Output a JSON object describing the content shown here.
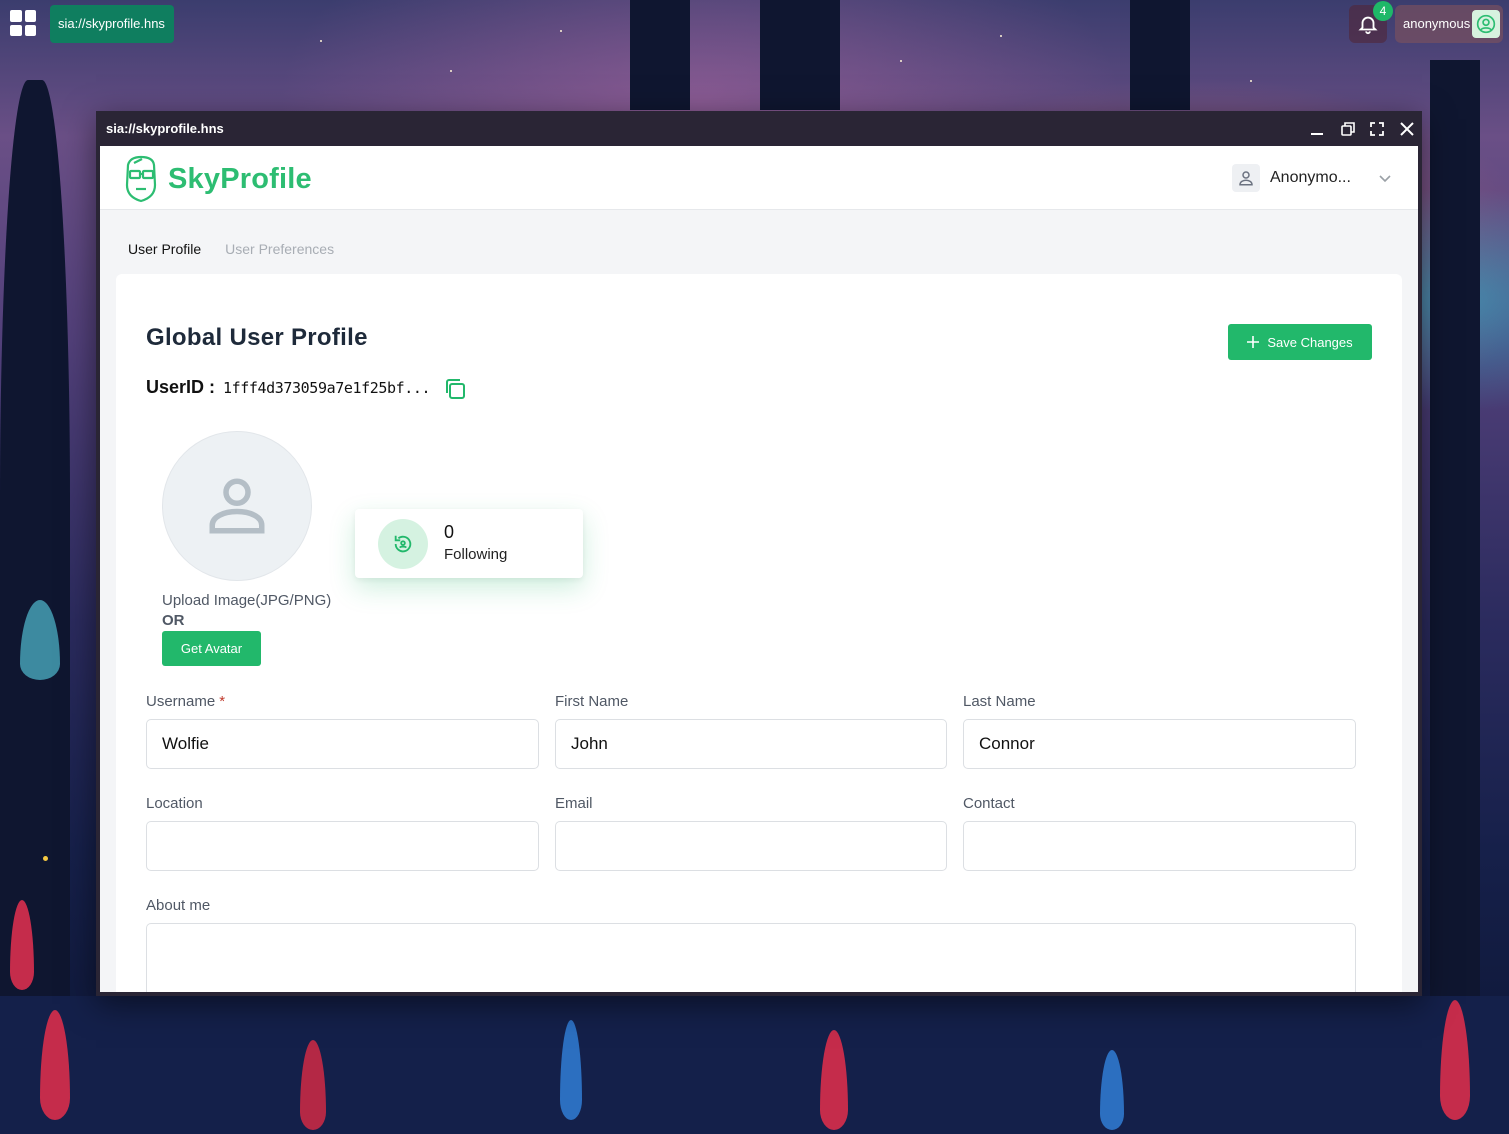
{
  "desktop": {
    "taskbar_tab": "sia://skyprofile.hns",
    "notification_count": "4",
    "user_name": "anonymous"
  },
  "window": {
    "title": "sia://skyprofile.hns"
  },
  "header": {
    "logo_text": "SkyProfile",
    "account_name": "Anonymo..."
  },
  "tabs": [
    {
      "label": "User Profile",
      "active": true
    },
    {
      "label": "User Preferences",
      "active": false
    }
  ],
  "profile": {
    "title": "Global User Profile",
    "save_label": "Save Changes",
    "userid_label": "UserID :",
    "userid_value": "1fff4d373059a7e1f25bf...",
    "upload_label": "Upload Image(JPG/PNG)",
    "or_label": "OR",
    "get_avatar_label": "Get Avatar",
    "following_count": "0",
    "following_label": "Following"
  },
  "form": {
    "username": {
      "label": "Username",
      "required_mark": "*",
      "value": "Wolfie"
    },
    "first_name": {
      "label": "First Name",
      "value": "John"
    },
    "last_name": {
      "label": "Last Name",
      "value": "Connor"
    },
    "location": {
      "label": "Location",
      "value": ""
    },
    "email": {
      "label": "Email",
      "value": ""
    },
    "contact": {
      "label": "Contact",
      "value": ""
    },
    "about": {
      "label": "About me",
      "value": ""
    }
  },
  "colors": {
    "brand_green": "#22b86b",
    "taskbar_tab": "#0f7e5f"
  }
}
